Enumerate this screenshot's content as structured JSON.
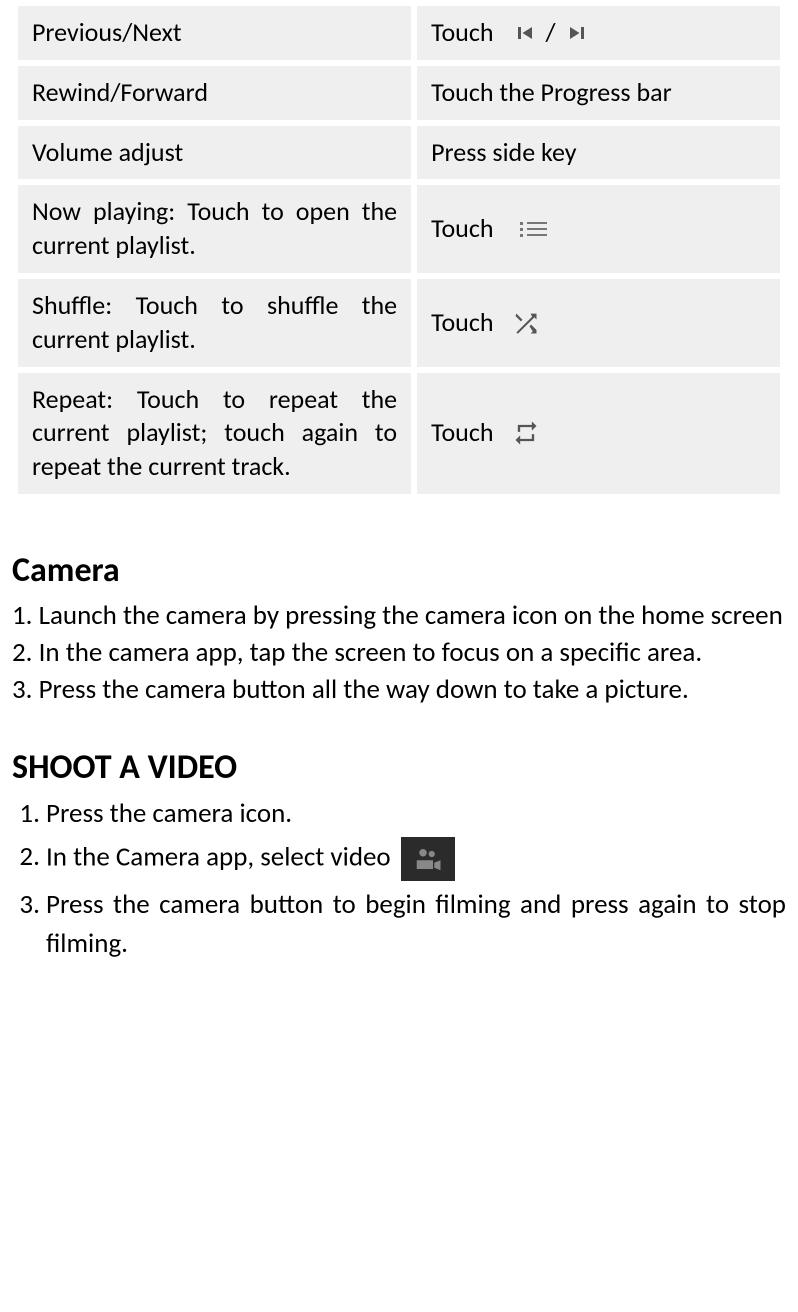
{
  "table": {
    "rows": [
      {
        "label": "Previous/Next",
        "action_prefix": "Touch",
        "slash": "/"
      },
      {
        "label": "Rewind/Forward",
        "action": "Touch the Progress bar"
      },
      {
        "label": "Volume adjust",
        "action": "Press side key"
      },
      {
        "label": "Now playing: Touch to open the current playlist.",
        "action_prefix": "Touch"
      },
      {
        "label": "Shuffle: Touch to shuffle the current playlist.",
        "action_prefix": "Touch"
      },
      {
        "label": "Repeat: Touch to repeat the current playlist; touch again to repeat the current track.",
        "action_prefix": "Touch"
      }
    ]
  },
  "camera": {
    "heading": "Camera",
    "step1": "1. Launch the camera by pressing the camera icon on the home screen",
    "step2": "2. In the camera app, tap the screen to focus on a specific area.",
    "step3": "3. Press the camera button all the way down to take a picture."
  },
  "video": {
    "heading": "SHOOT A VIDEO",
    "step1": "Press the camera icon.",
    "step2_prefix": "In the Camera app, select video",
    "step3": "Press the camera button to begin filming and press again to stop filming."
  }
}
